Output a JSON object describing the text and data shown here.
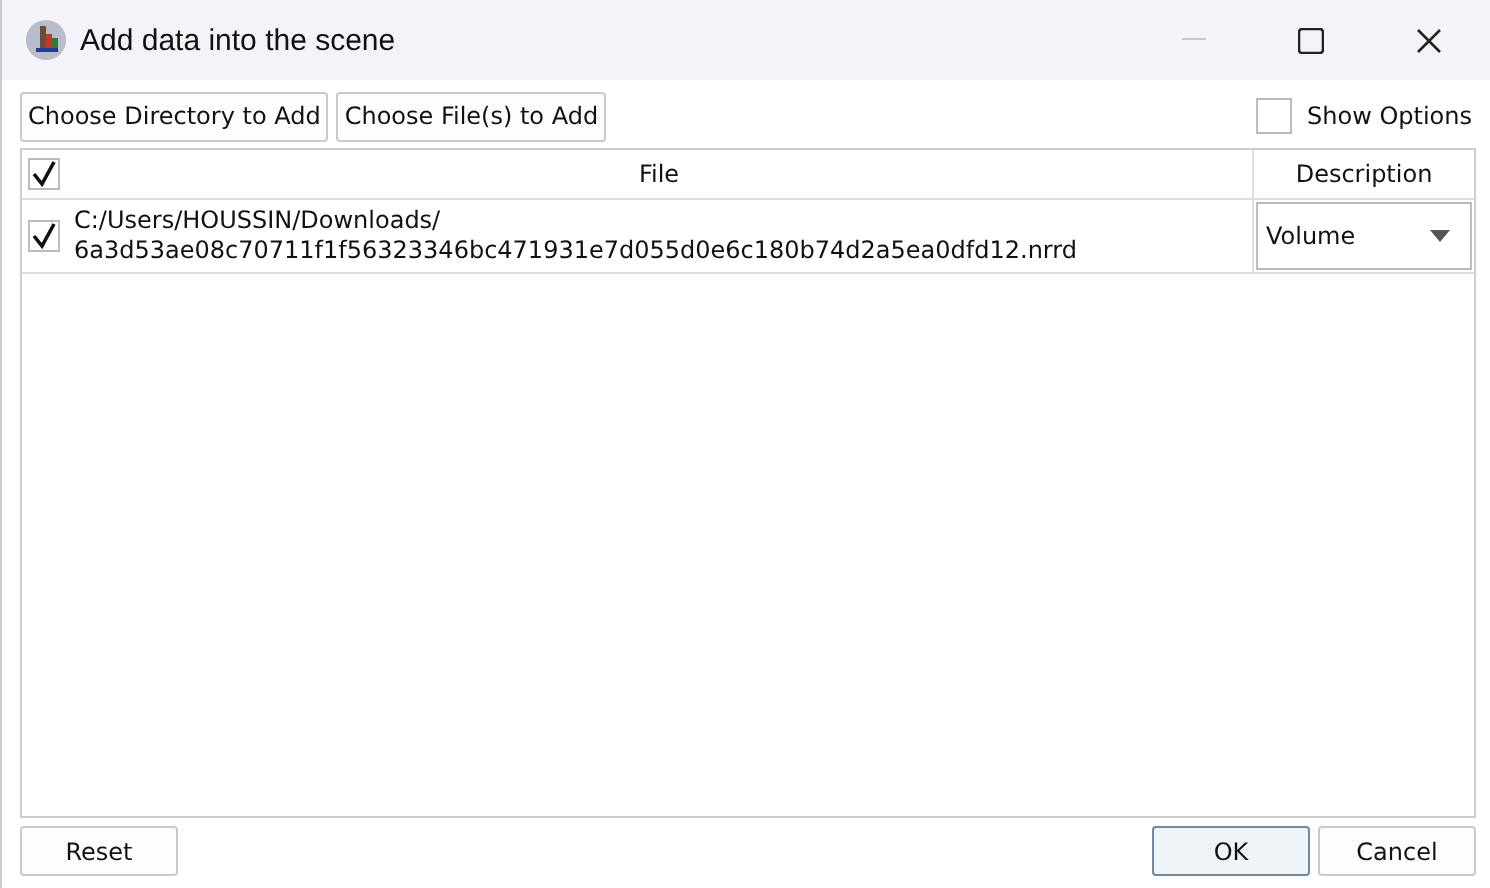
{
  "window": {
    "title": "Add data into the scene"
  },
  "toolbar": {
    "buttons": [
      "Choose Directory to Add",
      "Choose File(s) to Add"
    ],
    "show_options": {
      "label": "Show Options",
      "checked": false
    }
  },
  "table": {
    "header_checked": true,
    "columns": [
      "File",
      "Description"
    ],
    "rows": [
      {
        "checked": true,
        "file": "C:/Users/HOUSSIN/Downloads/\n6a3d53ae08c70711f1f56323346bc471931e7d055d0e6c180b74d2a5ea0dfd12.nrrd",
        "description": "Volume"
      }
    ]
  },
  "footer": [
    {
      "label": "Reset",
      "default": false
    },
    {
      "label": "OK",
      "default": true
    },
    {
      "label": "Cancel",
      "default": false
    }
  ]
}
